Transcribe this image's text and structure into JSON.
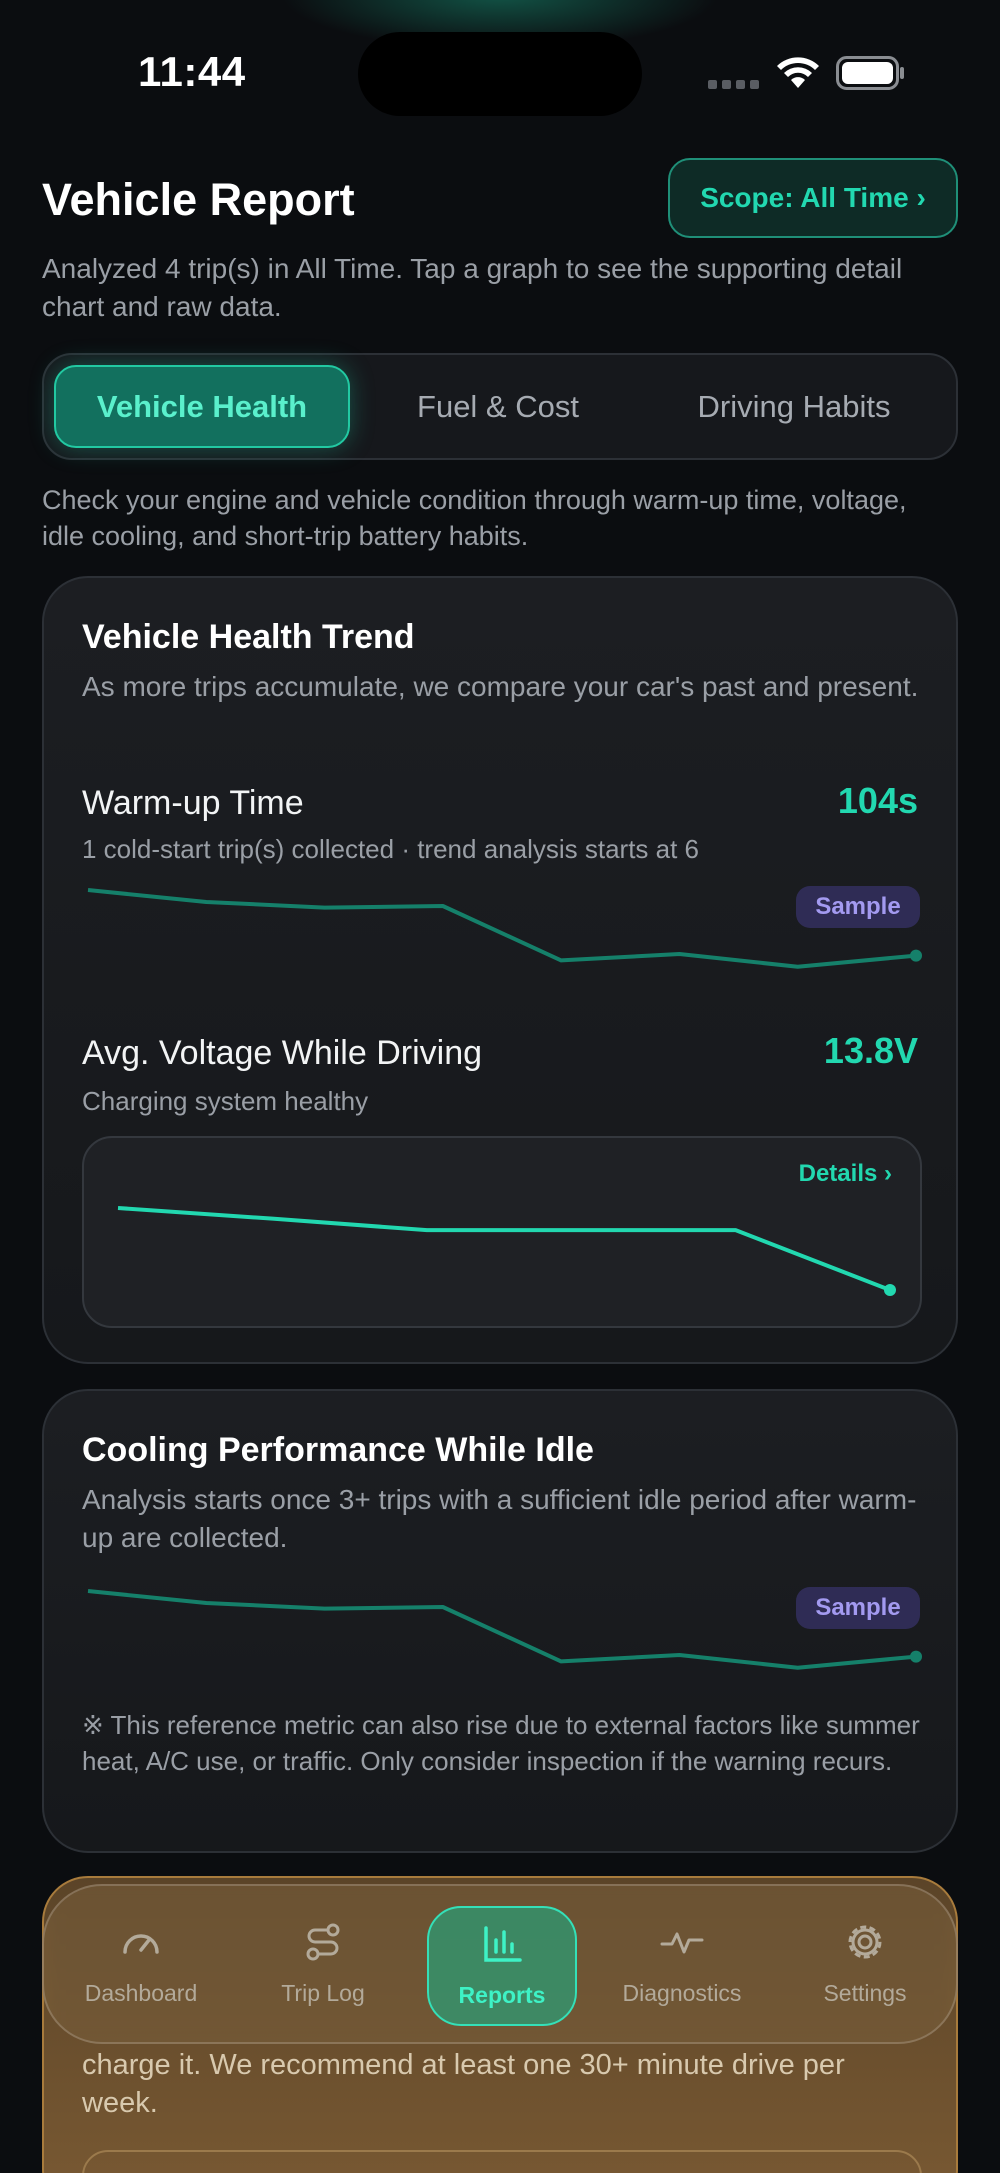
{
  "status_bar": {
    "time": "11:44"
  },
  "header": {
    "title": "Vehicle Report",
    "scope_button": "Scope: All Time ›",
    "subtitle": "Analyzed 4 trip(s) in All Time. Tap a graph to see the supporting detail chart and raw data."
  },
  "tabs": [
    {
      "label": "Vehicle Health",
      "active": true
    },
    {
      "label": "Fuel & Cost",
      "active": false
    },
    {
      "label": "Driving Habits",
      "active": false
    }
  ],
  "tab_description": "Check your engine and vehicle condition through warm-up time, voltage, idle cooling, and short-trip battery habits.",
  "health_card": {
    "title": "Vehicle Health Trend",
    "subtitle": "As more trips accumulate, we compare your car's past and present.",
    "warmup": {
      "label": "Warm-up Time",
      "value": "104s",
      "note": "1 cold-start trip(s) collected · trend analysis starts at 6",
      "badge": "Sample",
      "trend": [
        0.0,
        0.15,
        0.22,
        0.2,
        0.88,
        0.8,
        0.96,
        0.82
      ]
    },
    "voltage": {
      "label": "Avg. Voltage While Driving",
      "value": "13.8V",
      "note": "Charging system healthy",
      "details_link": "Details ›",
      "trend": [
        0.0,
        0.13,
        0.27,
        0.27,
        0.27,
        1.0
      ]
    }
  },
  "cooling_card": {
    "title": "Cooling Performance While Idle",
    "subtitle": "Analysis starts once 3+ trips with a sufficient idle period after warm-up are collected.",
    "badge": "Sample",
    "trend": [
      0.0,
      0.15,
      0.22,
      0.2,
      0.88,
      0.8,
      0.96,
      0.82
    ],
    "footnote": "※ This reference metric can also rise due to external factors like summer heat, A/C use, or traffic. Only consider inspection if the warning recurs."
  },
  "battery_card": {
    "text": "charge it. We recommend at least one 30+ minute drive per week."
  },
  "bottom_nav": [
    {
      "label": "Dashboard",
      "icon": "gauge-icon",
      "active": false
    },
    {
      "label": "Trip Log",
      "icon": "route-icon",
      "active": false
    },
    {
      "label": "Reports",
      "icon": "bar-chart-icon",
      "active": true
    },
    {
      "label": "Diagnostics",
      "icon": "pulse-icon",
      "active": false
    },
    {
      "label": "Settings",
      "icon": "gear-icon",
      "active": false
    }
  ],
  "colors": {
    "accent": "#22d8b0",
    "sample_badge": "#2f2c55",
    "warning_card": "#7a5a33"
  }
}
